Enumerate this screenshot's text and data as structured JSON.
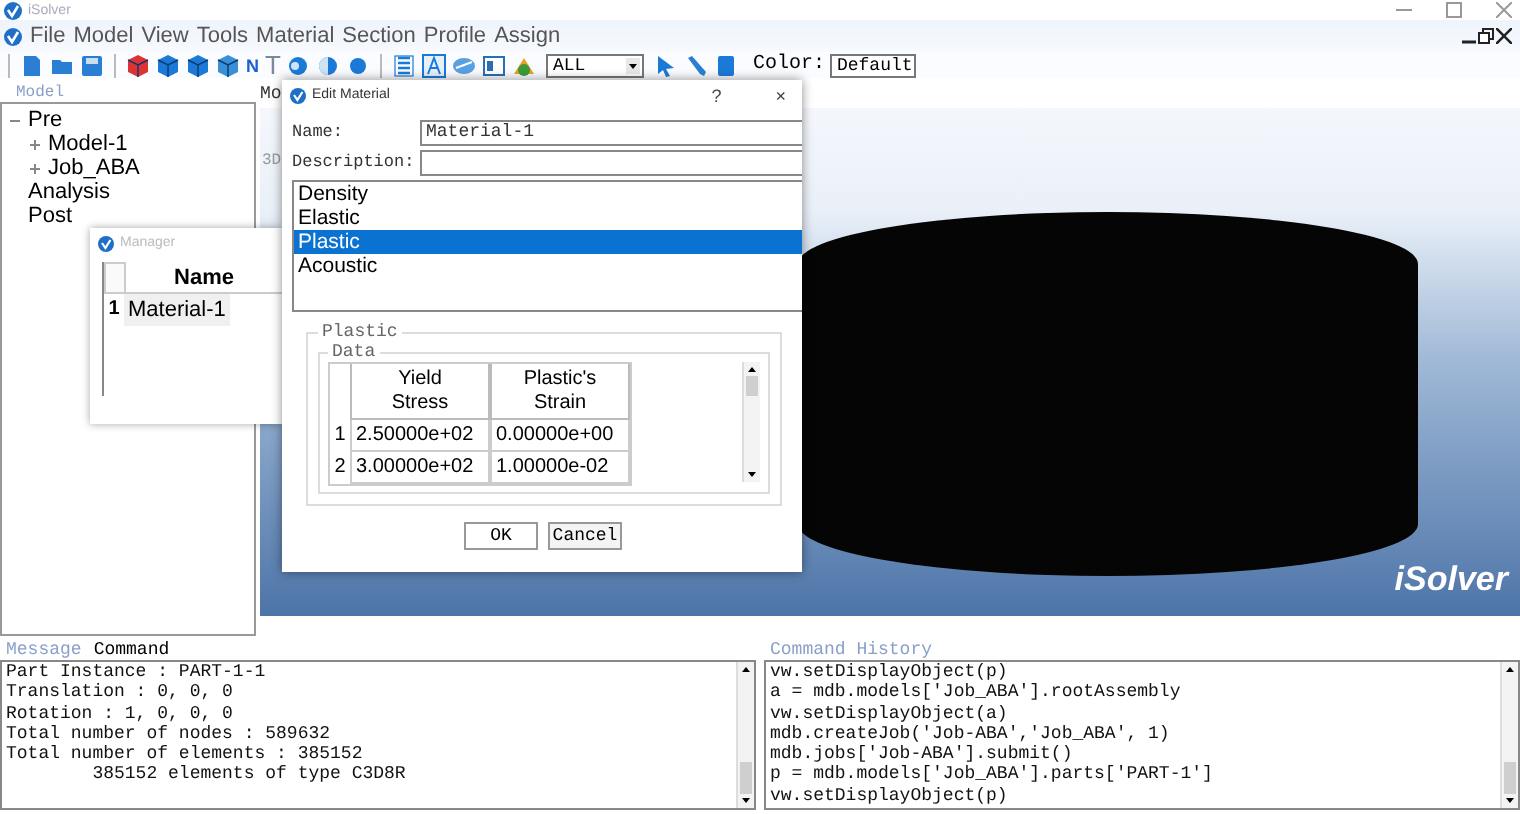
{
  "window": {
    "title": "iSolver"
  },
  "menu": [
    "File",
    "Model",
    "View",
    "Tools",
    "Material",
    "Section",
    "Profile",
    "Assign"
  ],
  "toolbar": {
    "label_tools": [
      "N",
      "T"
    ],
    "filter": "ALL",
    "color_label": "Color:",
    "color_value": "Default"
  },
  "model_panel": {
    "title": "Model",
    "tree": [
      {
        "label": "Pre",
        "kind": "branch",
        "expanded": true,
        "children": [
          {
            "label": "Model-1",
            "kind": "branch",
            "expanded": false
          },
          {
            "label": "Job_ABA",
            "kind": "branch",
            "expanded": false
          }
        ]
      },
      {
        "label": "Analysis",
        "kind": "leaf"
      },
      {
        "label": "Post",
        "kind": "leaf"
      }
    ]
  },
  "viewport": {
    "tab": "Mo",
    "view_label": "3D",
    "logo": "iSolver"
  },
  "manager": {
    "title": "Manager",
    "column": "Name",
    "rows": [
      {
        "index": "1",
        "name": "Material-1"
      }
    ]
  },
  "edit_material": {
    "title": "Edit Material",
    "help": "?",
    "close": "×",
    "name_label": "Name:",
    "name_value": "Material-1",
    "description_label": "Description:",
    "behaviors": [
      {
        "label": "Density",
        "selected": false
      },
      {
        "label": "Elastic",
        "selected": false
      },
      {
        "label": "Plastic",
        "selected": true
      },
      {
        "label": "Acoustic",
        "selected": false
      }
    ],
    "group_title": "Plastic",
    "data_title": "Data",
    "columns": [
      "Yield Stress",
      "Plastic's Strain"
    ],
    "rows": [
      {
        "index": "1",
        "cells": [
          "2.50000e+02",
          "0.00000e+00"
        ]
      },
      {
        "index": "2",
        "cells": [
          "3.00000e+02",
          "1.00000e-02"
        ]
      }
    ],
    "buttons": [
      "OK",
      "Cancel"
    ]
  },
  "message_panel": {
    "tabs": [
      {
        "label": "Message",
        "selected": false
      },
      {
        "label": "Command",
        "selected": true
      }
    ],
    "lines": [
      "Part Instance : PART-1-1",
      "Translation : 0, 0, 0",
      "Rotation : 1, 0, 0, 0",
      "Total number of nodes : 589632",
      "Total number of elements : 385152",
      "        385152 elements of type C3D8R"
    ]
  },
  "history_panel": {
    "title": "Command History",
    "lines": [
      "vw.setDisplayObject(p)",
      "a = mdb.models['Job_ABA'].rootAssembly",
      "vw.setDisplayObject(a)",
      "mdb.createJob('Job-ABA','Job_ABA', 1)",
      "mdb.jobs['Job-ABA'].submit()",
      "p = mdb.models['Job_ABA'].parts['PART-1']",
      "vw.setDisplayObject(p)"
    ]
  }
}
